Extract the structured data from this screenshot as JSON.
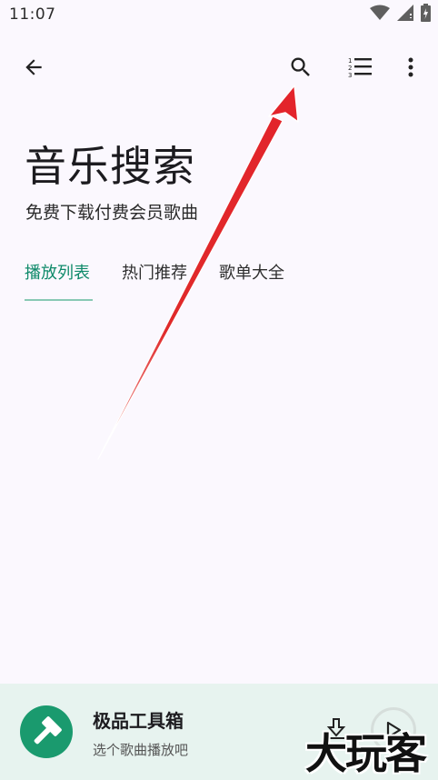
{
  "status_bar": {
    "time": "11:07"
  },
  "header": {
    "title": "音乐搜索",
    "subtitle": "免费下载付费会员歌曲"
  },
  "tabs": [
    {
      "label": "播放列表",
      "active": true
    },
    {
      "label": "热门推荐",
      "active": false
    },
    {
      "label": "歌单大全",
      "active": false
    }
  ],
  "player": {
    "title": "极品工具箱",
    "subtitle": "选个歌曲播放吧"
  },
  "watermark": "大玩客",
  "colors": {
    "accent": "#0f8a6a",
    "player_bg": "#e7f3ef",
    "app_icon": "#1a9a6e",
    "arrow": "#e3242b"
  },
  "icons": [
    "back-arrow-icon",
    "search-icon",
    "ordered-list-icon",
    "more-vert-icon",
    "wifi-icon",
    "signal-icon",
    "battery-icon",
    "hammer-icon",
    "download-icon",
    "play-icon"
  ]
}
